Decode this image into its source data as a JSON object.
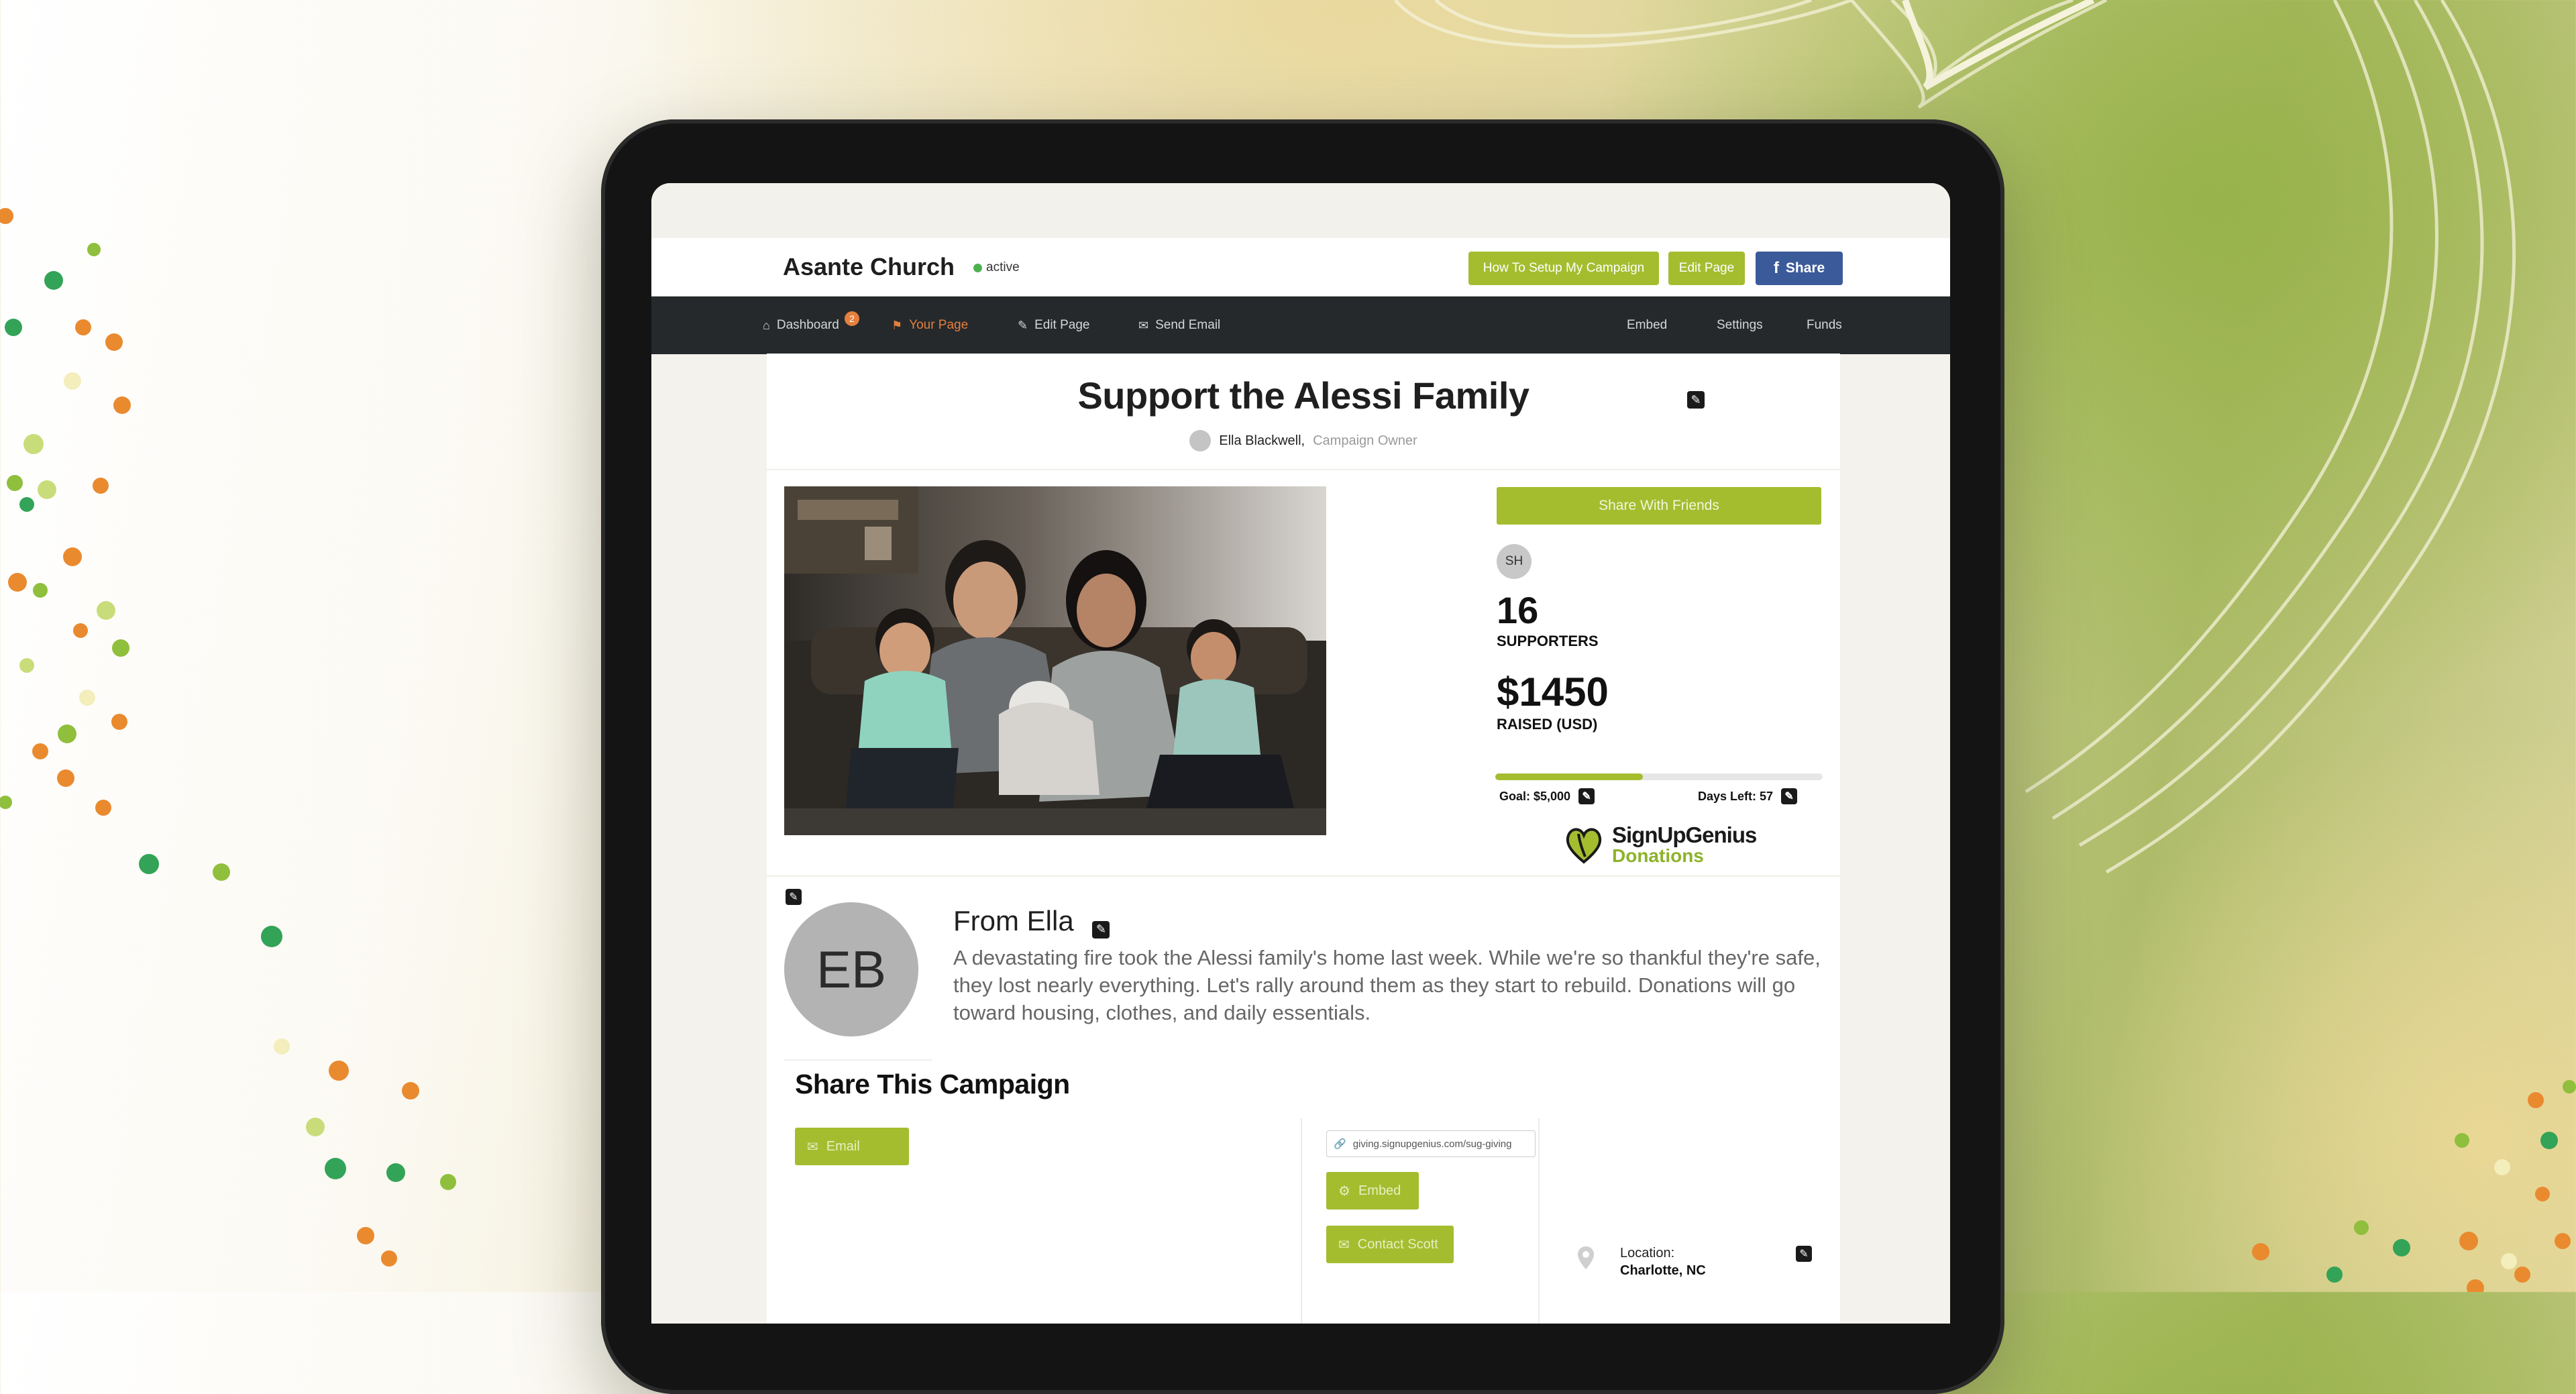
{
  "header": {
    "org_name": "Asante Church",
    "status": "active",
    "setup_button": "How To Setup My Campaign",
    "edit_button": "Edit Page",
    "share_button": "Share"
  },
  "nav": {
    "dashboard": "Dashboard",
    "dashboard_badge": "2",
    "your_page": "Your Page",
    "edit_page": "Edit Page",
    "send_email": "Send Email",
    "embed": "Embed",
    "settings": "Settings",
    "funds": "Funds"
  },
  "campaign": {
    "title": "Support the Alessi Family",
    "owner_name": "Ella Blackwell,",
    "owner_role": "Campaign Owner",
    "share_with_friends": "Share With Friends",
    "supporter_initials": "SH",
    "supporters_count": "16",
    "supporters_label": "SUPPORTERS",
    "raised_amount": "$1450",
    "raised_label": "RAISED (USD)",
    "progress_fraction": 0.45,
    "goal": "Goal: $5,000",
    "days_left": "Days Left: 57"
  },
  "logo": {
    "line1": "SignUpGenius",
    "line2": "Donations"
  },
  "message": {
    "initials": "EB",
    "from_title": "From Ella",
    "body": "A devastating fire took the Alessi family's home last week. While we're so thankful they're safe, they lost nearly everything. Let's rally around them as they start to rebuild. Donations will go toward housing, clothes, and daily essentials."
  },
  "share": {
    "title": "Share This Campaign",
    "email_button": "Email",
    "url": "giving.signupgenius.com/sug-giving",
    "embed_button": "Embed",
    "contact_button": "Contact Scott",
    "location_label": "Location:",
    "location_value": "Charlotte, NC"
  },
  "colors": {
    "accent_green": "#a4bd2f",
    "facebook_blue": "#3b5a9a",
    "nav_dark": "#25292c",
    "active_orange": "#e57f3d"
  }
}
